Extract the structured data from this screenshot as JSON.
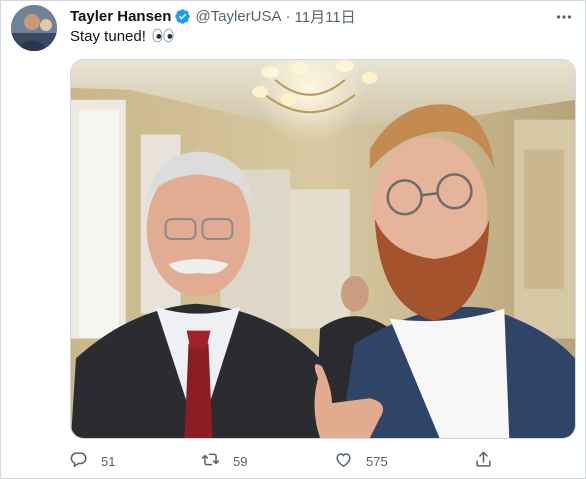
{
  "tweet": {
    "author": {
      "display_name": "Tayler Hansen",
      "handle": "@TaylerUSA",
      "verified": true
    },
    "separator": "·",
    "timestamp": "11月11日",
    "text": "Stay tuned!",
    "emoji_icon": "eyes-emoji",
    "media_alt": "",
    "stats": {
      "replies": "51",
      "retweets": "59",
      "likes": "575"
    }
  },
  "icons": {
    "verified": "verified-badge-icon",
    "more": "more-options-icon",
    "reply": "reply-icon",
    "retweet": "retweet-icon",
    "like": "heart-icon",
    "share": "share-icon"
  },
  "colors": {
    "verified_blue": "#1d9bf0",
    "secondary_text": "#536471",
    "primary_text": "#0f1419",
    "border": "#cfd9de"
  }
}
